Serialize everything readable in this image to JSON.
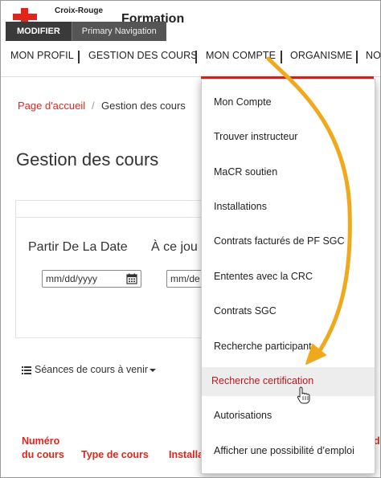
{
  "header": {
    "logo_line1": "Croix-Rouge",
    "site_title": "Formation",
    "admin_modifier": "MODIFIER",
    "admin_primary_nav": "Primary Navigation"
  },
  "nav": {
    "items": [
      "MON PROFIL",
      "GESTION DES COURS",
      "MON COMPTE",
      "ORGANISME",
      "NO"
    ]
  },
  "breadcrumb": {
    "home": "Page d'accueil",
    "sep": "/",
    "current": "Gestion des cours"
  },
  "page_title": "Gestion des cours",
  "filters": {
    "from_label": "Partir De La Date",
    "to_label": "À ce jou",
    "from_placeholder": "mm/dd/yyyy",
    "to_placeholder": "mm/de"
  },
  "sessions_label": "Séances de cours à venir",
  "table": {
    "col1_line1": "Numéro",
    "col1_line2": "du cours",
    "col2": "Type de cours",
    "col3": "Installa",
    "col4_fragment": "de"
  },
  "dropdown": {
    "items": [
      "Mon Compte",
      "Trouver instructeur",
      "MaCR soutien",
      "Installations",
      "Contrats facturés de PF SGC",
      "Ententes avec la CRC",
      "Contrats SGC",
      "Recherche participant",
      "Recherche certification",
      "Autorisations",
      "Afficher une possibilité d’emploi"
    ],
    "highlighted_index": 8
  },
  "colors": {
    "brand_red": "#e1251b",
    "annotation_arrow": "#f0a81c"
  },
  "icons": [
    "red-cross-logo-icon",
    "calendar-icon",
    "list-icon",
    "caret-down-icon",
    "hand-cursor-icon",
    "annotation-arrow"
  ]
}
